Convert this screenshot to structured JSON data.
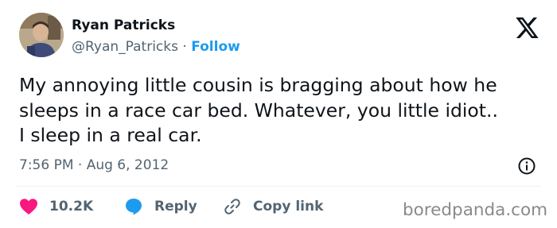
{
  "author": {
    "name": "Ryan Patricks",
    "handle": "@Ryan_Patricks",
    "separator": "·",
    "follow_label": "Follow"
  },
  "tweet": {
    "lines": [
      "My annoying little cousin is bragging about how he",
      "sleeps in a race car bed. Whatever, you little idiot..",
      "I sleep in a real car."
    ],
    "timestamp": "7:56 PM · Aug 6, 2012"
  },
  "actions": {
    "like_count": "10.2K",
    "reply_label": "Reply",
    "copy_label": "Copy link"
  },
  "watermark": "boredpanda.com",
  "colors": {
    "accent": "#1d9bf0",
    "like": "#f91880",
    "text": "#0f1419",
    "muted": "#536471"
  },
  "icons": [
    "x-logo-icon",
    "info-icon",
    "heart-icon",
    "reply-bubble-icon",
    "link-icon"
  ]
}
